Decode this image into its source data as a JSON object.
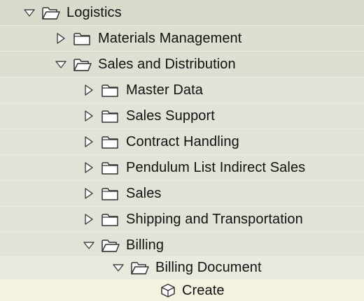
{
  "tree": {
    "logistics": "Logistics",
    "materials_management": "Materials Management",
    "sales_and_distribution": "Sales and Distribution",
    "master_data": "Master Data",
    "sales_support": "Sales Support",
    "contract_handling": "Contract Handling",
    "pendulum_list": "Pendulum List Indirect Sales",
    "sales": "Sales",
    "shipping": "Shipping and Transportation",
    "billing": "Billing",
    "billing_document": "Billing Document",
    "create": "Create"
  },
  "colors": {
    "row_level_0": "#d7dbcc",
    "row_level_1": "#dcdfd2",
    "row_level_2": "#e0e3d7",
    "row_level_3": "#e7eadf",
    "row_selected": "#f4f2df"
  },
  "icons": {
    "expanded": "triangle-down-icon",
    "collapsed": "triangle-right-icon",
    "open_folder": "open-folder-icon",
    "closed_folder": "closed-folder-icon",
    "transaction": "cube-icon"
  }
}
